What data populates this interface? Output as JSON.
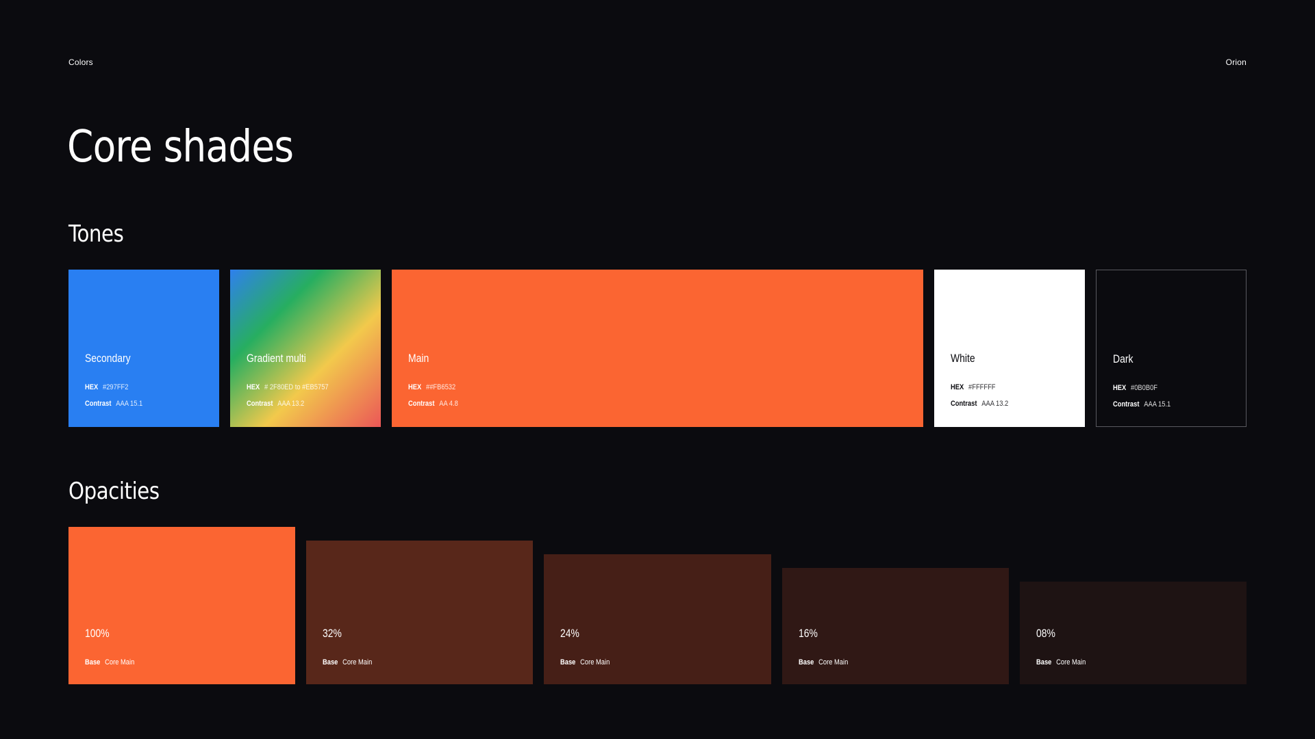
{
  "header": {
    "section": "Colors",
    "brand": "Orion"
  },
  "title": "Core shades",
  "tones": {
    "heading": "Tones",
    "hex_label": "HEX",
    "contrast_label": "Contrast",
    "items": [
      {
        "name": "Secondary",
        "hex": "#297FF2",
        "contrast": "AAA 15.1",
        "color": "#297FF2"
      },
      {
        "name": "Gradient multi",
        "hex": "# 2F80ED to #EB5757",
        "contrast": "AAA 13.2",
        "color": "gradient"
      },
      {
        "name": "Main",
        "hex": "##FB6532",
        "contrast": "AA 4.8",
        "color": "#FB6532"
      },
      {
        "name": "White",
        "hex": "#FFFFFF",
        "contrast": "AAA 13.2",
        "color": "#FFFFFF"
      },
      {
        "name": "Dark",
        "hex": "#0B0B0F",
        "contrast": "AAA 15.1",
        "color": "#0B0B0F"
      }
    ]
  },
  "opacities": {
    "heading": "Opacities",
    "base_label": "Base",
    "base_value": "Core Main",
    "items": [
      {
        "percent": "100%",
        "opacity": 1.0
      },
      {
        "percent": "32%",
        "opacity": 0.32
      },
      {
        "percent": "24%",
        "opacity": 0.24
      },
      {
        "percent": "16%",
        "opacity": 0.16
      },
      {
        "percent": "08%",
        "opacity": 0.08
      }
    ]
  }
}
